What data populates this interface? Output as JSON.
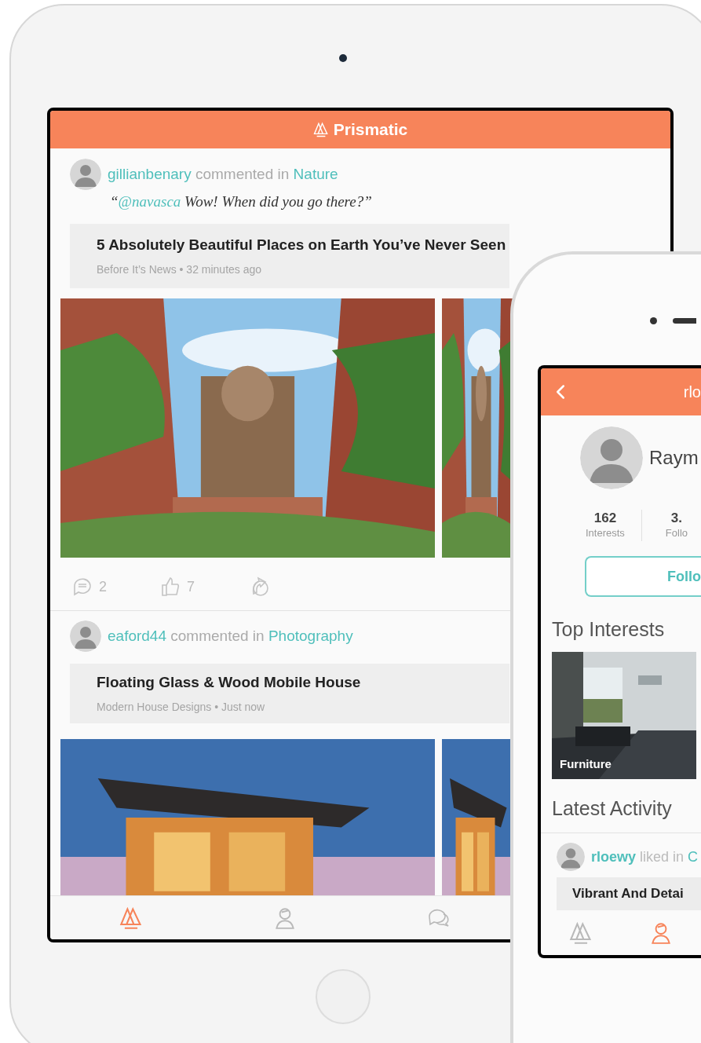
{
  "tablet": {
    "app_title": "Prismatic",
    "feed": [
      {
        "user": "gillianbenary",
        "action": "commented in",
        "topic": "Nature",
        "quote": {
          "open": "“",
          "mention": "@navasca",
          "text": "Wow! When did you go there?”"
        },
        "article": {
          "title": "5 Absolutely Beautiful Places on Earth You’ve Never Seen",
          "meta": "Before It’s News • 32 minutes ago"
        },
        "stats": {
          "comments": "2",
          "likes": "7"
        }
      },
      {
        "user": "eaford44",
        "action": "commented in",
        "topic": "Photography",
        "article": {
          "title": "Floating Glass & Wood Mobile House",
          "meta": "Modern House Designs • Just now"
        }
      }
    ],
    "tabs": [
      {
        "kind": "home",
        "selected": true
      },
      {
        "kind": "profile",
        "selected": false
      },
      {
        "kind": "chat",
        "selected": false
      }
    ]
  },
  "phone": {
    "title": "rlo",
    "name": "Raym",
    "stats": [
      {
        "value": "162",
        "label": "Interests"
      },
      {
        "value": "3.",
        "label": "Follo"
      }
    ],
    "follow_button": "Follo",
    "top_interests_heading": "Top Interests",
    "interests": [
      {
        "label": "Furniture"
      }
    ],
    "latest_activity_heading": "Latest Activity",
    "activity": {
      "user": "rloewy",
      "action": "liked in",
      "topic": "C",
      "article_title": "Vibrant And Detai"
    },
    "tabs": [
      {
        "kind": "home",
        "selected": false
      },
      {
        "kind": "profile",
        "selected": true
      }
    ]
  }
}
